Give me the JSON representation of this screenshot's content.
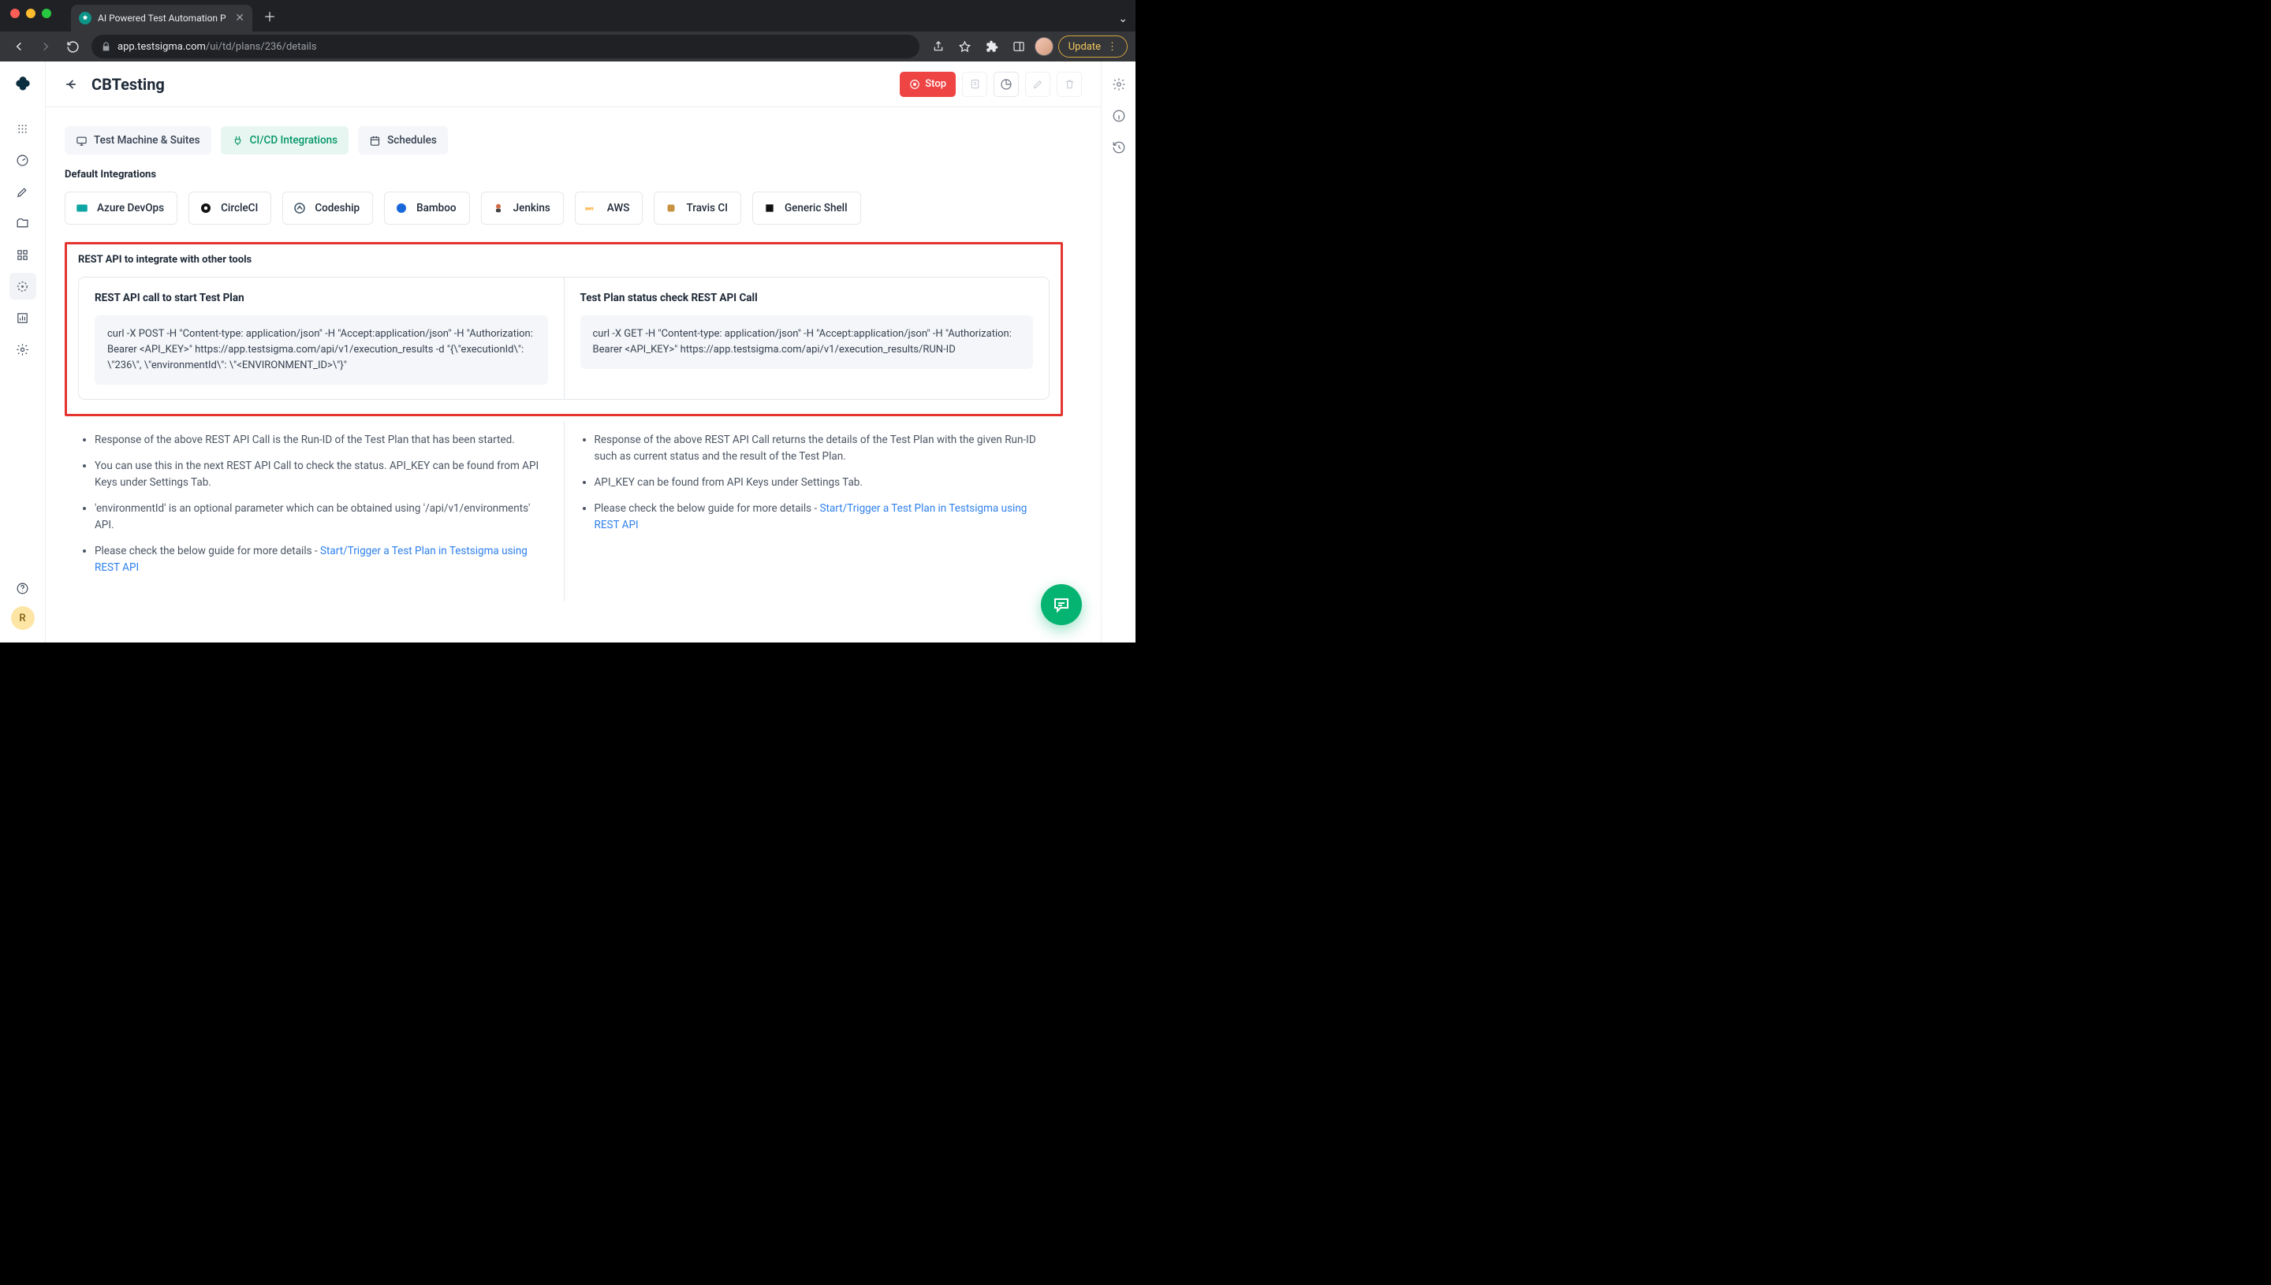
{
  "browser": {
    "tab_title": "AI Powered Test Automation P",
    "url_domain": "app.testsigma.com",
    "url_path": "/ui/td/plans/236/details",
    "update_label": "Update"
  },
  "header": {
    "title": "CBTesting",
    "stop_label": "Stop"
  },
  "tabs": {
    "machine": "Test Machine & Suites",
    "cicd": "CI/CD Integrations",
    "schedules": "Schedules"
  },
  "section_default": "Default Integrations",
  "integrations": [
    "Azure DevOps",
    "CircleCI",
    "Codeship",
    "Bamboo",
    "Jenkins",
    "AWS",
    "Travis CI",
    "Generic Shell"
  ],
  "rest_title": "REST API to integrate with other tools",
  "left_api": {
    "title": "REST API call to start Test Plan",
    "code": "curl -X POST -H \"Content-type: application/json\" -H \"Accept:application/json\" -H \"Authorization: Bearer <API_KEY>\" https://app.testsigma.com/api/v1/execution_results -d \"{\\\"executionId\\\": \\\"236\\\", \\\"environmentId\\\": \\\"<ENVIRONMENT_ID>\\\"}\"",
    "notes": [
      "Response of the above REST API Call is the Run-ID of the Test Plan that has been started.",
      "You can use this in the next REST API Call to check the status. API_KEY can be found from API Keys under Settings Tab.",
      "'environmentId' is an optional parameter which can be obtained using '/api/v1/environments' API."
    ],
    "note_link_prefix": "Please check the below guide for more details - ",
    "note_link_label": "Start/Trigger a Test Plan in Testsigma using REST API"
  },
  "right_api": {
    "title": "Test Plan status check REST API Call",
    "code": "curl -X GET -H \"Content-type: application/json\" -H \"Accept:application/json\" -H \"Authorization: Bearer <API_KEY>\" https://app.testsigma.com/api/v1/execution_results/RUN-ID",
    "notes": [
      "Response of the above REST API Call returns the details of the Test Plan with the given Run-ID such as current status and the result of the Test Plan.",
      "API_KEY can be found from API Keys under Settings Tab."
    ],
    "note_link_prefix": "Please check the below guide for more details - ",
    "note_link_label": "Start/Trigger a Test Plan in Testsigma using REST API"
  },
  "user_initial": "R"
}
